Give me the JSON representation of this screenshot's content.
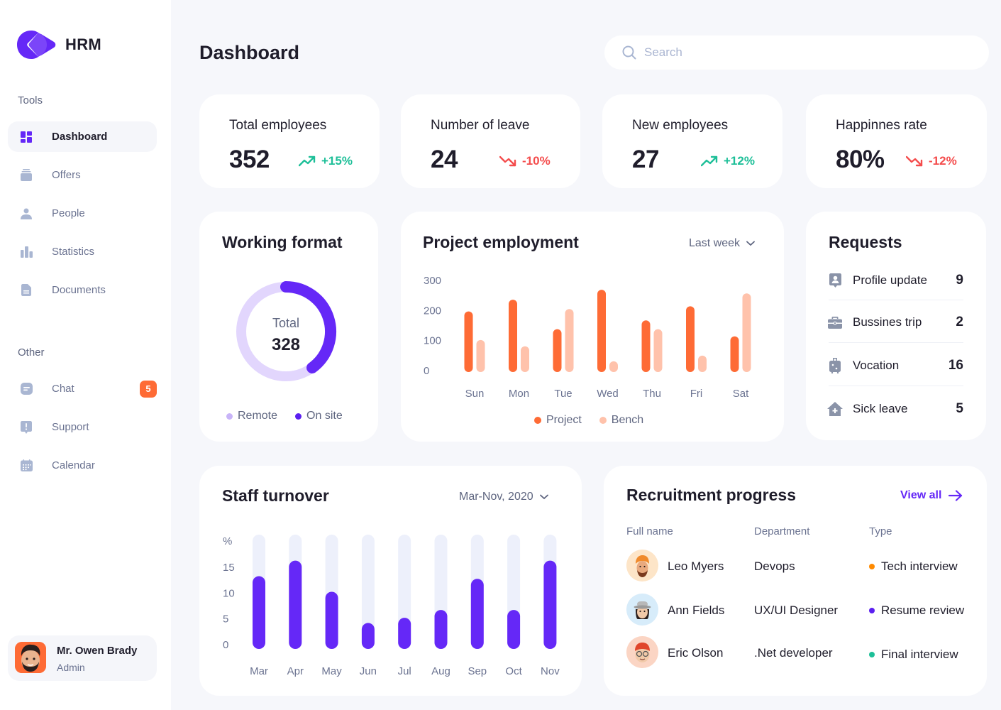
{
  "brand": {
    "name": "HRM",
    "accent": "#6528f7"
  },
  "sidebar": {
    "tools_label": "Tools",
    "other_label": "Other",
    "tools": [
      {
        "label": "Dashboard",
        "icon": "dashboard-icon",
        "active": true
      },
      {
        "label": "Offers",
        "icon": "offers-icon"
      },
      {
        "label": "People",
        "icon": "people-icon"
      },
      {
        "label": "Statistics",
        "icon": "statistics-icon"
      },
      {
        "label": "Documents",
        "icon": "documents-icon"
      }
    ],
    "other": [
      {
        "label": "Chat",
        "icon": "chat-icon",
        "badge": "5"
      },
      {
        "label": "Support",
        "icon": "support-icon"
      },
      {
        "label": "Calendar",
        "icon": "calendar-icon"
      }
    ],
    "user": {
      "name": "Mr. Owen Brady",
      "role": "Admin"
    }
  },
  "header": {
    "title": "Dashboard",
    "search_placeholder": "Search",
    "search_value": ""
  },
  "stats": [
    {
      "title": "Total employees",
      "value": "352",
      "trend": "+15%",
      "direction": "up"
    },
    {
      "title": "Number of leave",
      "value": "24",
      "trend": "-10%",
      "direction": "down"
    },
    {
      "title": "New employees",
      "value": "27",
      "trend": "+12%",
      "direction": "up"
    },
    {
      "title": "Happinnes rate",
      "value": "80%",
      "trend": "-12%",
      "direction": "down"
    }
  ],
  "colors": {
    "up": "#1dbf98",
    "down": "#f44c4c",
    "project": "#fe6b35",
    "bench": "#ffc2ab",
    "onsite": "#6528f7",
    "remote": "#e2d6fd",
    "turnover": "#6528f7",
    "track": "#edf0fb"
  },
  "working_format": {
    "title": "Working format",
    "center_label": "Total",
    "center_value": "328",
    "legend": [
      "Remote",
      "On site"
    ]
  },
  "project_employment": {
    "title": "Project employment",
    "period": "Last week",
    "legend": [
      "Project",
      "Bench"
    ]
  },
  "requests": {
    "title": "Requests",
    "items": [
      {
        "label": "Profile update",
        "count": "9",
        "icon": "profile-update-icon"
      },
      {
        "label": "Bussines trip",
        "count": "2",
        "icon": "briefcase-icon"
      },
      {
        "label": "Vocation",
        "count": "16",
        "icon": "suitcase-icon"
      },
      {
        "label": "Sick leave",
        "count": "5",
        "icon": "medical-house-icon"
      }
    ]
  },
  "staff_turnover": {
    "title": "Staff turnover",
    "period": "Mar-Nov, 2020"
  },
  "recruitment": {
    "title": "Recruitment progress",
    "view_all": "View all",
    "columns": [
      "Full name",
      "Department",
      "Type"
    ],
    "rows": [
      {
        "name": "Leo Myers",
        "department": "Devops",
        "type": "Tech interview",
        "type_color": "#ff8a00",
        "avatar_bg": "#fde5c8"
      },
      {
        "name": "Ann Fields",
        "department": "UX/UI Designer",
        "type": "Resume review",
        "type_color": "#5b1ff0",
        "avatar_bg": "#d7ecfa"
      },
      {
        "name": "Eric Olson",
        "department": ".Net developer",
        "type": "Final interview",
        "type_color": "#1dbf98",
        "avatar_bg": "#fbd5c4"
      }
    ]
  },
  "chart_data": [
    {
      "type": "pie",
      "title": "Working format",
      "categories": [
        "Remote",
        "On site"
      ],
      "values_fraction": [
        0.6,
        0.4
      ],
      "total": 328,
      "style": "donut"
    },
    {
      "type": "bar",
      "title": "Project employment",
      "categories": [
        "Sun",
        "Mon",
        "Tue",
        "Wed",
        "Thu",
        "Fri",
        "Sat"
      ],
      "series": [
        {
          "name": "Project",
          "values": [
            197,
            236,
            138,
            269,
            167,
            214,
            114
          ]
        },
        {
          "name": "Bench",
          "values": [
            102,
            81,
            205,
            31,
            138,
            50,
            257
          ]
        }
      ],
      "yticks": [
        0,
        100,
        200,
        300
      ],
      "ylim": [
        0,
        300
      ],
      "xlabel": "",
      "ylabel": "",
      "legend": "bottom"
    },
    {
      "type": "bar",
      "title": "Staff turnover",
      "categories": [
        "Mar",
        "Apr",
        "May",
        "Jun",
        "Jul",
        "Aug",
        "Sep",
        "Oct",
        "Nov"
      ],
      "values": [
        14,
        17,
        11,
        5,
        6,
        7.5,
        13.5,
        7.5,
        17
      ],
      "yticks": [
        0,
        5,
        10,
        15
      ],
      "ylabel": "%",
      "ylim": [
        0,
        22
      ],
      "xlabel": ""
    }
  ]
}
